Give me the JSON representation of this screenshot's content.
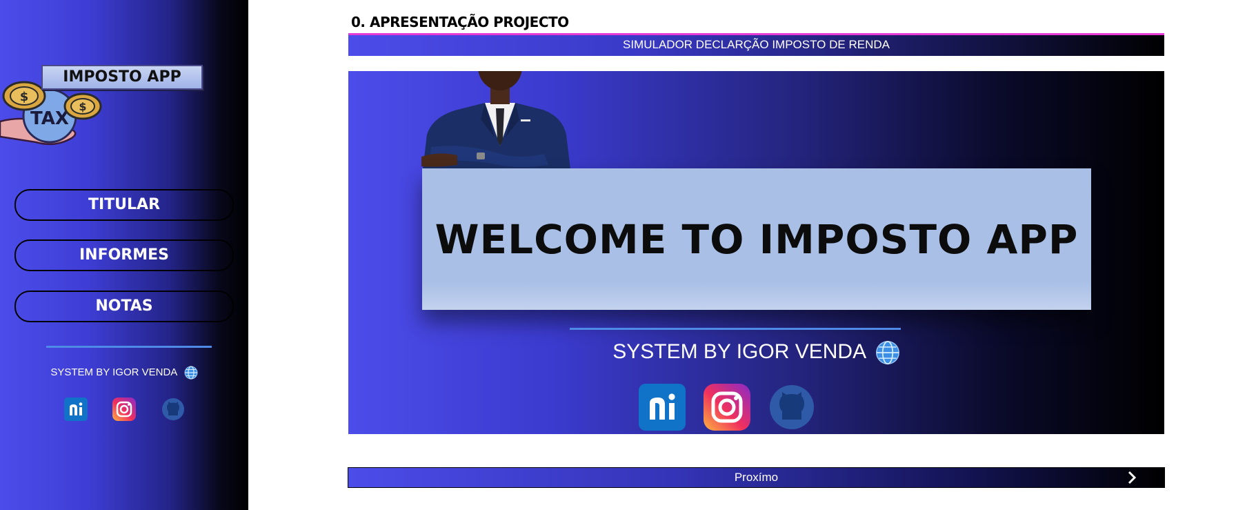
{
  "sidebar": {
    "logo_title": "IMPOSTO APP",
    "logo_icon": "tax-coins-hand-icon",
    "nav": [
      {
        "label": "TITULAR"
      },
      {
        "label": "INFORMES"
      },
      {
        "label": "NOTAS"
      }
    ],
    "credit": "SYSTEM BY IGOR VENDA",
    "social": [
      "ni-icon",
      "instagram-icon",
      "github-icon"
    ]
  },
  "main": {
    "page_title": "0. APRESENTAÇÃO PROJECTO",
    "banner": "SIMULADOR DECLARÇÃO IMPOSTO DE RENDA",
    "hero": {
      "welcome": "WELCOME TO IMPOSTO APP",
      "credit": "SYSTEM BY IGOR VENDA"
    },
    "next_label": "Proxímo"
  },
  "colors": {
    "accent_blue": "#4c4cea",
    "pink_line": "#e63ad6",
    "card_blue": "#a9bfe6",
    "divider_blue": "#4f8be6"
  }
}
